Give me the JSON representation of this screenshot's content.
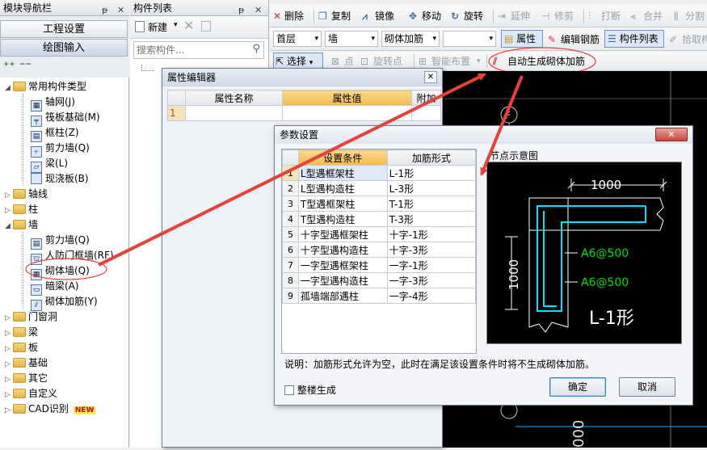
{
  "nav_panel": {
    "title": "模块导航栏",
    "btn_project": "工程设置",
    "btn_draw": "绘图输入"
  },
  "tree": [
    {
      "label": "常用构件类型",
      "kind": "folder",
      "open": true,
      "level": 0
    },
    {
      "label": "轴网(J)",
      "kind": "item",
      "level": 1
    },
    {
      "label": "筏板基础(M)",
      "kind": "item",
      "level": 1
    },
    {
      "label": "框柱(Z)",
      "kind": "item",
      "level": 1
    },
    {
      "label": "剪力墙(Q)",
      "kind": "item",
      "level": 1
    },
    {
      "label": "梁(L)",
      "kind": "item",
      "level": 1
    },
    {
      "label": "现浇板(B)",
      "kind": "item",
      "level": 1
    },
    {
      "label": "轴线",
      "kind": "folder",
      "open": false,
      "level": 0
    },
    {
      "label": "柱",
      "kind": "folder",
      "open": false,
      "level": 0
    },
    {
      "label": "墙",
      "kind": "folder",
      "open": true,
      "level": 0
    },
    {
      "label": "剪力墙(Q)",
      "kind": "item",
      "level": 1
    },
    {
      "label": "人防门框墙(RF)",
      "kind": "item",
      "level": 1
    },
    {
      "label": "砌体墙(Q)",
      "kind": "item",
      "level": 1
    },
    {
      "label": "暗梁(A)",
      "kind": "item",
      "level": 1
    },
    {
      "label": "砌体加筋(Y)",
      "kind": "item",
      "level": 1
    },
    {
      "label": "门窗洞",
      "kind": "folder",
      "open": false,
      "level": 0
    },
    {
      "label": "梁",
      "kind": "folder",
      "open": false,
      "level": 0
    },
    {
      "label": "板",
      "kind": "folder",
      "open": false,
      "level": 0
    },
    {
      "label": "基础",
      "kind": "folder",
      "open": false,
      "level": 0
    },
    {
      "label": "其它",
      "kind": "folder",
      "open": false,
      "level": 0
    },
    {
      "label": "自定义",
      "kind": "folder",
      "open": false,
      "level": 0
    },
    {
      "label": "CAD识别",
      "kind": "folder",
      "open": false,
      "level": 0,
      "badge": "NEW"
    }
  ],
  "component_list": {
    "title": "构件列表",
    "new_label": "新建",
    "search_placeholder": "搜索构件..."
  },
  "toolbar1": {
    "delete": "删除",
    "copy": "复制",
    "mirror": "镜像",
    "move": "移动",
    "rotate": "旋转",
    "extend": "延伸",
    "trim": "修剪",
    "break": "打断",
    "merge": "合并",
    "split": "分割"
  },
  "toolbar2": {
    "floor": "首层",
    "category": "墙",
    "type": "砌体加筋",
    "element": "",
    "properties": "属性",
    "edit_rebar": "编辑钢筋",
    "component_list": "构件列表",
    "pick": "拾取构"
  },
  "toolbar3": {
    "select": "选择",
    "point": "点",
    "rotate_point": "旋转点",
    "smart_layout": "智能布置",
    "auto_generate": "自动生成砌体加筋"
  },
  "property_editor": {
    "title": "属性编辑器",
    "col_name": "属性名称",
    "col_value": "属性值",
    "col_extra": "附加",
    "row_num": "1"
  },
  "param_dialog": {
    "title": "参数设置",
    "col_condition": "设置条件",
    "col_form": "加筋形式",
    "rows": [
      {
        "no": "1",
        "condition": "L型遇框架柱",
        "form": "L-1形"
      },
      {
        "no": "2",
        "condition": "L型遇构造柱",
        "form": "L-3形"
      },
      {
        "no": "3",
        "condition": "T型遇框架柱",
        "form": "T-1形"
      },
      {
        "no": "4",
        "condition": "T型遇构造柱",
        "form": "T-3形"
      },
      {
        "no": "5",
        "condition": "十字型遇框架柱",
        "form": "十字-1形"
      },
      {
        "no": "6",
        "condition": "十字型遇构造柱",
        "form": "十字-3形"
      },
      {
        "no": "7",
        "condition": "一字型遇框架柱",
        "form": "一字-1形"
      },
      {
        "no": "8",
        "condition": "一字型遇构造柱",
        "form": "一字-3形"
      },
      {
        "no": "9",
        "condition": "孤墙端部遇柱",
        "form": "一字-4形"
      }
    ],
    "preview_title": "节点示意图",
    "preview_dim_top": "1000",
    "preview_dim_left": "1000",
    "preview_rebar1": "A6@500",
    "preview_rebar2": "A6@500",
    "preview_label": "L-1形",
    "note": "说明：加筋形式允许为空，此时在满足该设置条件时将不生成砌体加筋。",
    "whole_building": "整楼生成",
    "ok": "确定",
    "cancel": "取消"
  },
  "cad": {
    "axis_label": "F",
    "dim_text": "000"
  },
  "colors": {
    "accent_red": "#e8403a",
    "cad_bg": "#000000",
    "rebar_cyan": "#00e5ff",
    "rebar_green": "#00e000",
    "header_orange": "#f7c86a"
  }
}
